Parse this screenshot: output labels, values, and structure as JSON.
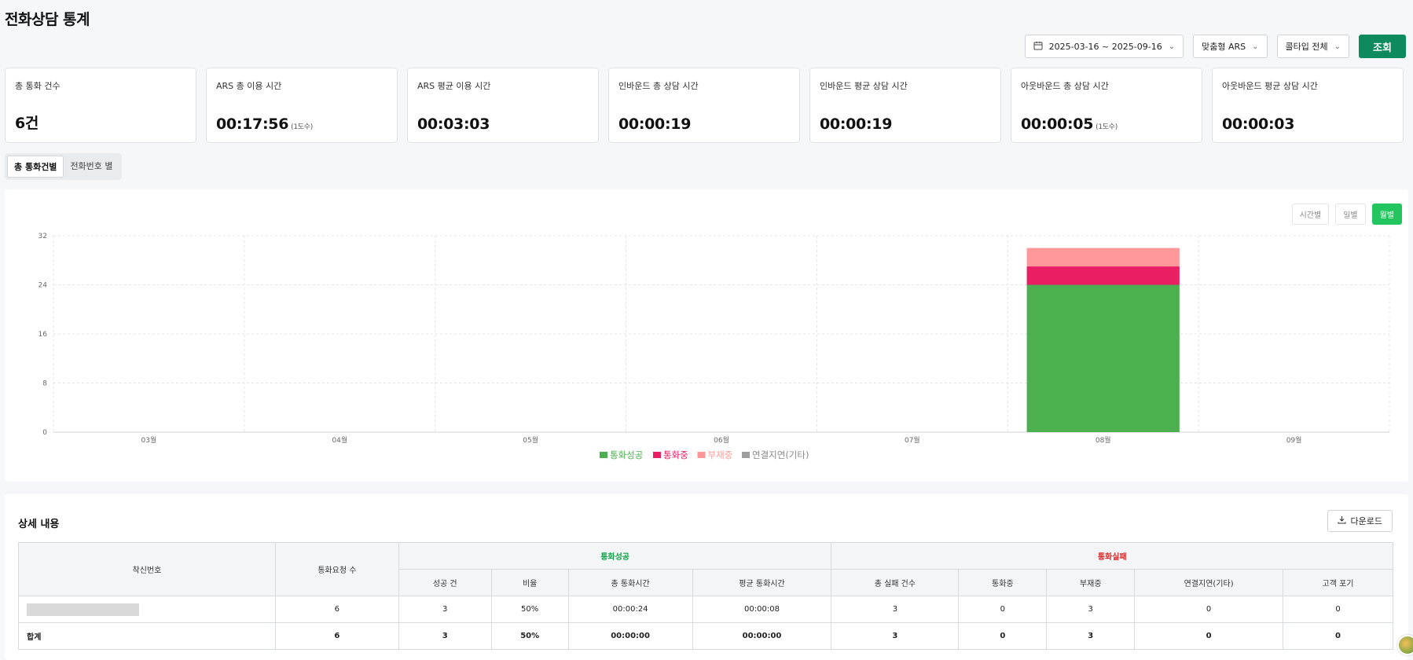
{
  "page": {
    "title": "전화상담 통계"
  },
  "filters": {
    "date_range": "2025-03-16 ~ 2025-09-16",
    "ars_type": "맞춤형 ARS",
    "call_type": "콜타입 전체",
    "search_label": "조회",
    "icons": {
      "calendar": "calendar-icon",
      "chevron": "chevron-down-icon"
    }
  },
  "stats": [
    {
      "label": "총 통화 건수",
      "value": "6건",
      "unit": ""
    },
    {
      "label": "ARS 총 이용 시간",
      "value": "00:17:56",
      "unit": "(1도수)"
    },
    {
      "label": "ARS 평균 이용 시간",
      "value": "00:03:03",
      "unit": ""
    },
    {
      "label": "인바운드 총 상담 시간",
      "value": "00:00:19",
      "unit": ""
    },
    {
      "label": "인바운드 평균 상담 시간",
      "value": "00:00:19",
      "unit": ""
    },
    {
      "label": "아웃바운드 총 상담 시간",
      "value": "00:00:05",
      "unit": "(1도수)"
    },
    {
      "label": "아웃바운드 평균 상담 시간",
      "value": "00:00:03",
      "unit": ""
    }
  ],
  "view_tabs": {
    "by_total": "총 통화건별",
    "by_number": "전화번호 별"
  },
  "granularity": {
    "hourly": "시간별",
    "daily": "일별",
    "monthly": "월별",
    "active": "monthly"
  },
  "chart_data": {
    "type": "bar",
    "stacked": true,
    "categories": [
      "03월",
      "04월",
      "05월",
      "06월",
      "07월",
      "08월",
      "09월"
    ],
    "series": [
      {
        "name": "통화성공",
        "color": "#4caf50",
        "values": [
          0,
          0,
          0,
          0,
          0,
          24,
          0
        ]
      },
      {
        "name": "통화중",
        "color": "#e91e63",
        "values": [
          0,
          0,
          0,
          0,
          0,
          3,
          0
        ]
      },
      {
        "name": "부재중",
        "color": "#ff9999",
        "values": [
          0,
          0,
          0,
          0,
          0,
          3,
          0
        ]
      },
      {
        "name": "연결지연(기타)",
        "color": "#9e9e9e",
        "values": [
          0,
          0,
          0,
          0,
          0,
          0,
          0
        ]
      }
    ],
    "yticks": [
      0,
      8,
      16,
      24,
      32
    ],
    "ylim": [
      0,
      32
    ],
    "grid": true,
    "legend": "bottom"
  },
  "detail": {
    "title": "상세 내용",
    "download_label": "다운로드",
    "headers": {
      "number": "착신번호",
      "requests": "통화요청 수",
      "success_group": "통화성공",
      "failure_group": "통화실패",
      "success_count": "성공 건",
      "ratio": "비율",
      "total_time": "총 통화시간",
      "avg_time": "평균 통화시간",
      "fail_total": "총 실패 건수",
      "busy": "통화중",
      "absent": "부재중",
      "delay": "연결지연(기타)",
      "abandon": "고객 포기"
    },
    "rows": [
      {
        "number": "",
        "requests": "6",
        "success": "3",
        "ratio": "50%",
        "total_time": "00:00:24",
        "avg_time": "00:00:08",
        "fail_total": "3",
        "busy": "0",
        "absent": "3",
        "delay": "0",
        "abandon": "0"
      }
    ],
    "total": {
      "label": "합계",
      "requests": "6",
      "success": "3",
      "ratio": "50%",
      "total_time": "00:00:00",
      "avg_time": "00:00:00",
      "fail_total": "3",
      "busy": "0",
      "absent": "3",
      "delay": "0",
      "abandon": "0"
    }
  }
}
